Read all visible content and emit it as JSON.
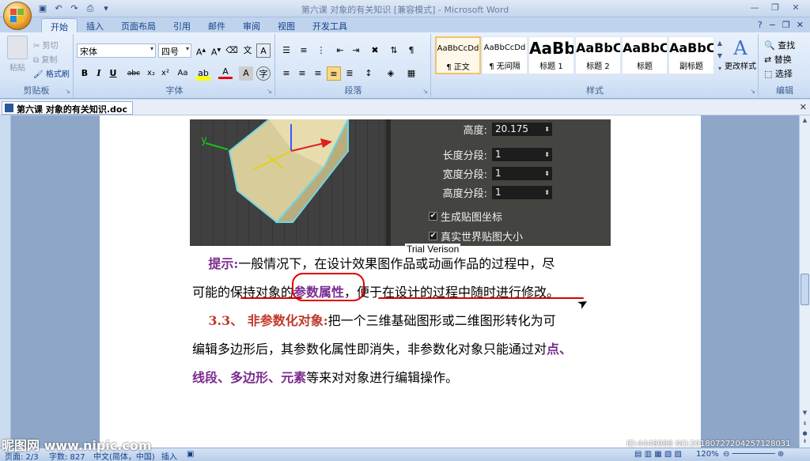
{
  "window": {
    "title": "第六课 对象的有关知识 [兼容模式] - Microsoft Word",
    "qat": [
      "save-icon",
      "undo-icon",
      "redo-icon",
      "print-preview-icon"
    ]
  },
  "tabs": [
    "开始",
    "插入",
    "页面布局",
    "引用",
    "邮件",
    "审阅",
    "视图",
    "开发工具"
  ],
  "active_tab": "开始",
  "ribbon": {
    "clipboard": {
      "label": "剪贴板",
      "paste": "粘贴",
      "cut": "剪切",
      "copy": "复制",
      "format_painter": "格式刷"
    },
    "font": {
      "label": "字体",
      "font_name": "宋体",
      "font_size": "四号"
    },
    "paragraph": {
      "label": "段落"
    },
    "styles": {
      "label": "样式",
      "items": [
        {
          "preview": "AaBbCcDd",
          "name": "¶ 正文"
        },
        {
          "preview": "AaBbCcDd",
          "name": "¶ 无间隔"
        },
        {
          "preview": "AaBb",
          "name": "标题 1"
        },
        {
          "preview": "AaBbC",
          "name": "标题 2"
        },
        {
          "preview": "AaBbC",
          "name": "标题"
        },
        {
          "preview": "AaBbC",
          "name": "副标题"
        }
      ],
      "change_styles": "更改样式"
    },
    "editing": {
      "label": "编辑",
      "find": "查找",
      "replace": "替换",
      "select": "选择"
    }
  },
  "document": {
    "tab_title": "第六课 对象的有关知识.doc",
    "image": {
      "rows": [
        {
          "label": "高度:",
          "value": "20.175"
        },
        {
          "label": "长度分段:",
          "value": "1"
        },
        {
          "label": "宽度分段:",
          "value": "1"
        },
        {
          "label": "高度分段:",
          "value": "1"
        }
      ],
      "checks": [
        "生成贴图坐标",
        "真实世界贴图大小"
      ],
      "axis_y": "y"
    },
    "trial": "Trial Verison",
    "p1": {
      "lead": "提示:",
      "text1": "一般情况下，在设计效果图作品或动画作品的过程中，尽",
      "text2a": "可能的保持对象的",
      "highlight": "参数属性",
      "text2b": "，便于在设计的过程中随时进行修改。"
    },
    "p2": {
      "lead": "3.3、 非参数化对象:",
      "text1": "把一个三维基础图形或二维图形转化为可",
      "text2a": "编辑多边形后，其参数化属性即消失，非参数化对象只能通过对",
      "t_point": "点、",
      "t_line": "线段",
      "sep1": "、",
      "t_poly": "多边形",
      "sep2": "、",
      "t_elem": "元素",
      "text3": "等来对对象进行编辑操作。"
    }
  },
  "status": {
    "page": "页面: 2/3",
    "words": "字数: 827",
    "lang": "中文(简体，中国)",
    "mode": "插入",
    "zoom": "120%"
  },
  "overlay": {
    "watermark": "昵图网 www.nipic.com",
    "id": "ID:4448988 NO:20180727204257128031"
  },
  "colors": {
    "accent_purple": "#7b2c8f",
    "accent_red": "#c0392b",
    "annotation": "#dd0000"
  }
}
